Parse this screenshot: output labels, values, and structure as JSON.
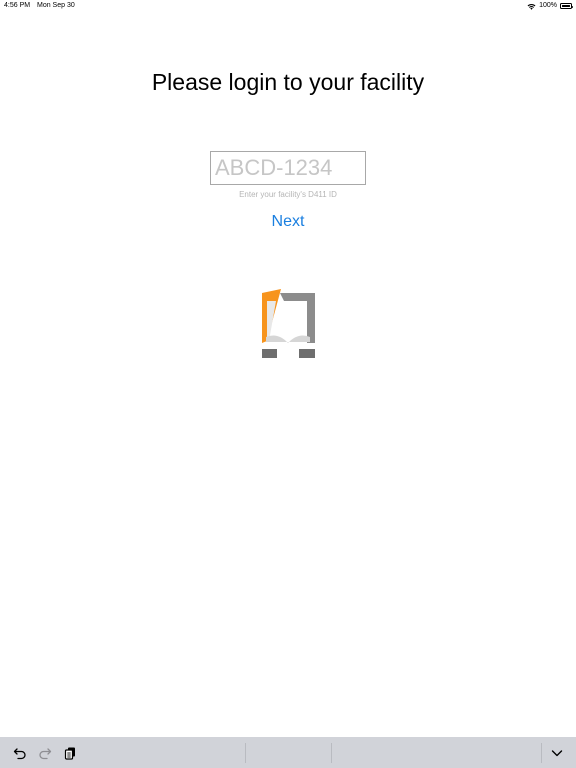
{
  "status_bar": {
    "time": "4:56 PM",
    "date": "Mon Sep 30",
    "battery_percent": "100%",
    "icons": [
      "wifi-icon",
      "battery-icon"
    ]
  },
  "login": {
    "title": "Please login to your facility",
    "id_field": {
      "value": "",
      "placeholder": "ABCD-1234"
    },
    "hint": "Enter your facility's D411 ID",
    "next_label": "Next"
  },
  "logo": {
    "icon": "facility-logo",
    "colors": {
      "accent": "#f7941d",
      "frame": "#8c8c8c",
      "frame_light": "#c8c8c8"
    }
  },
  "shortcut_bar": {
    "icons": [
      "undo-icon",
      "redo-icon",
      "paste-icon",
      "dismiss-keyboard-icon"
    ],
    "background": "#d1d3d9"
  },
  "colors": {
    "link": "#1a7fe0",
    "input_border": "#a8a8a8",
    "placeholder": "#c6c6c6",
    "hint": "#b5b5b5"
  }
}
